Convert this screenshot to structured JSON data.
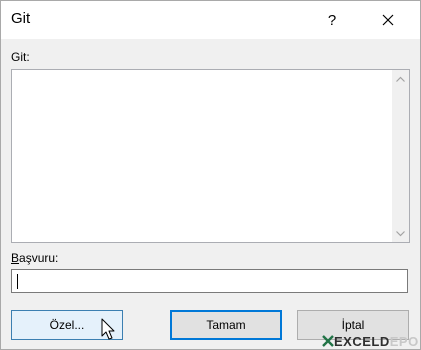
{
  "window": {
    "title": "Git",
    "help_label": "?"
  },
  "goto_list": {
    "label": "Git:",
    "items": []
  },
  "reference": {
    "label_first": "B",
    "label_rest": "aşvuru:",
    "value": ""
  },
  "buttons": {
    "special": "Özel...",
    "ok": "Tamam",
    "cancel": "İptal"
  },
  "watermark": {
    "brand": "EXCELD",
    "suffix": "EPO"
  },
  "colors": {
    "dialog_bg": "#f0f0f0",
    "focus_border": "#0078d7",
    "hover_bg": "#e5f1fb"
  }
}
